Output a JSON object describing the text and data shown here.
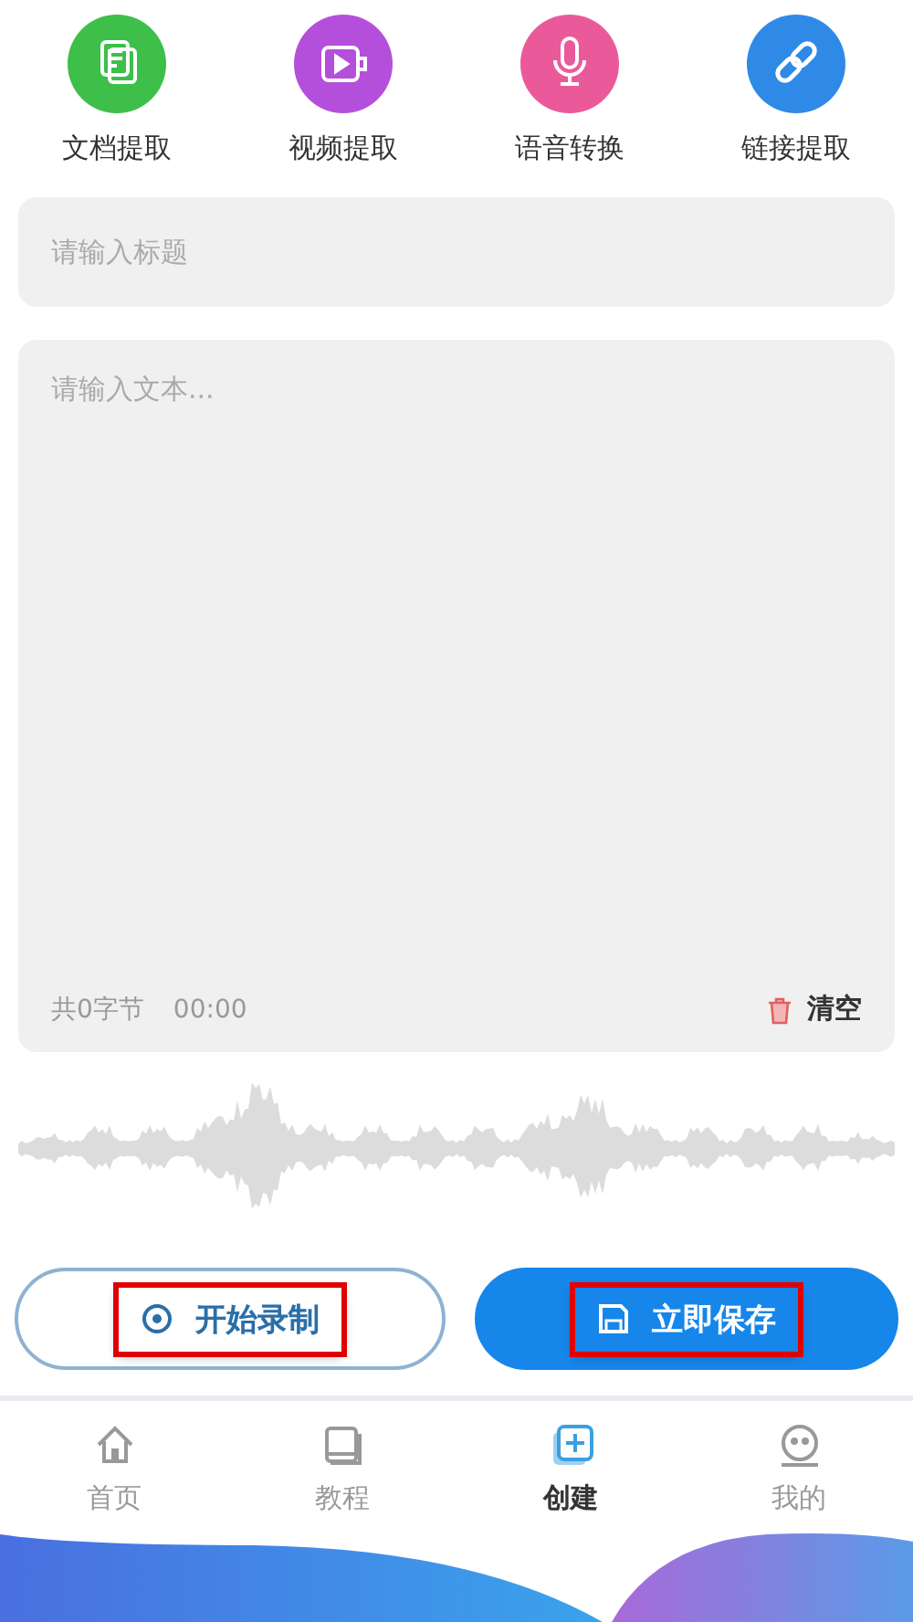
{
  "tools": [
    {
      "label": "文档提取",
      "kind": "document",
      "color": "#3dbf4a"
    },
    {
      "label": "视频提取",
      "kind": "video",
      "color": "#b44fdc"
    },
    {
      "label": "语音转换",
      "kind": "voice",
      "color": "#ea5a9a"
    },
    {
      "label": "链接提取",
      "kind": "link",
      "color": "#2e8ae6"
    }
  ],
  "title_field": {
    "placeholder": "请输入标题"
  },
  "text_area": {
    "placeholder": "请输入文本...",
    "byte_count": "共0字节",
    "duration": "00:00",
    "clear_label": "清空"
  },
  "actions": [
    {
      "label": "开始录制",
      "kind": "record",
      "highlighted": true
    },
    {
      "label": "立即保存",
      "kind": "save",
      "highlighted": true
    }
  ],
  "nav": [
    {
      "label": "首页",
      "kind": "home",
      "selected": false
    },
    {
      "label": "教程",
      "kind": "tutorial",
      "selected": false
    },
    {
      "label": "创建",
      "kind": "create",
      "selected": true
    },
    {
      "label": "我的",
      "kind": "profile",
      "selected": false
    }
  ]
}
